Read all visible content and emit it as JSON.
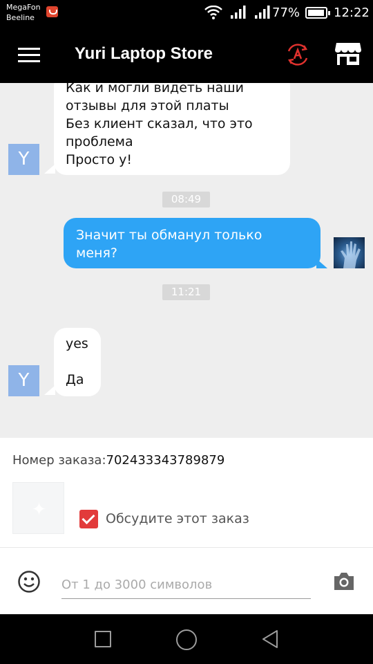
{
  "status_bar": {
    "carrier_1": "MegaFon",
    "carrier_2": "Beeline",
    "battery": "77%",
    "time": "12:22"
  },
  "header": {
    "title": "Yuri Laptop Store",
    "icons": [
      "menu-icon",
      "translate-icon",
      "store-icon"
    ]
  },
  "chat": {
    "seller_initial": "Y",
    "messages": [
      {
        "from": "seller",
        "lines": [
          "Как и могли видеть наши",
          "отзывы для этой платы",
          "Без клиент сказал, что это",
          "проблема",
          "Просто у!"
        ]
      },
      {
        "type": "time",
        "text": "08:49"
      },
      {
        "from": "me",
        "lines": [
          "Значит ты обманул только",
          "меня?"
        ]
      },
      {
        "type": "time",
        "text": "11:21"
      },
      {
        "from": "seller",
        "lines": [
          "yes",
          "",
          "Да"
        ]
      }
    ]
  },
  "order": {
    "label": "Номер заказа:",
    "number": "702433343789879",
    "discuss_label": "Обсудите этот заказ",
    "discuss_checked": true
  },
  "input": {
    "placeholder": "От 1 до 3000 символов"
  },
  "colors": {
    "outgoing_bubble": "#2ea4f5",
    "seller_avatar": "#8fb4e8",
    "checkbox": "#e23b3b",
    "chat_background": "#eeeeee"
  }
}
